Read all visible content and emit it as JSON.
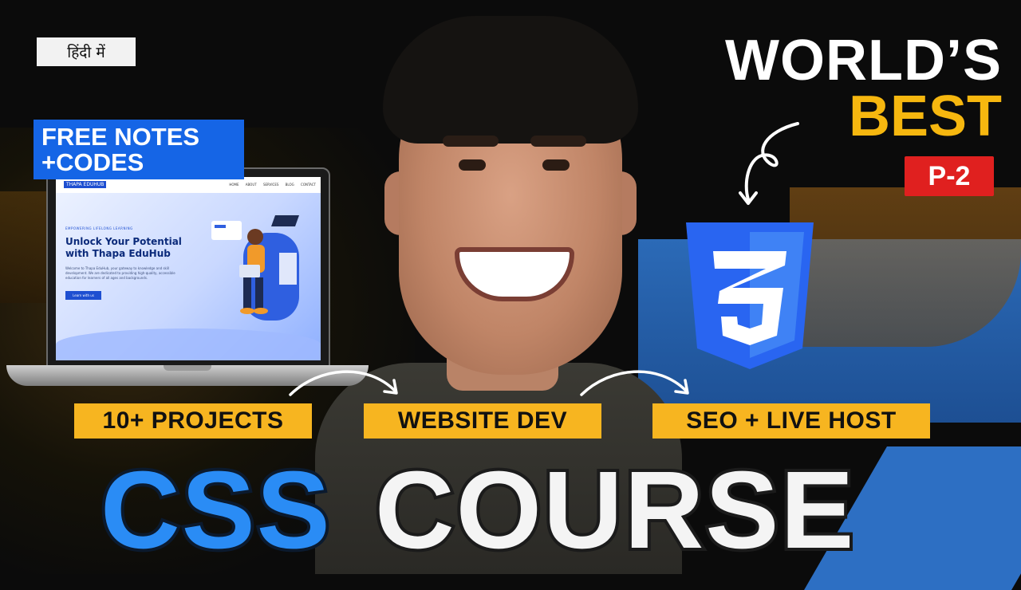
{
  "language_badge": "हिंदी में",
  "free_notes": {
    "line1": "FREE NOTES",
    "line2": "+CODES"
  },
  "headline": {
    "line1": "WORLD’S",
    "line2": "BEST"
  },
  "part_badge": "P-2",
  "tags": [
    "10+ PROJECTS",
    "WEBSITE DEV",
    "SEO + LIVE HOST"
  ],
  "title": {
    "css": "CSS",
    "course": "COURSE"
  },
  "laptop_site": {
    "logo": "THAPA EDUHUB",
    "nav": [
      "HOME",
      "ABOUT",
      "SERVICES",
      "BLOG",
      "CONTACT"
    ],
    "eyebrow": "EMPOWERING LIFELONG LEARNING",
    "heading": "Unlock Your Potential with Thapa EduHub",
    "body": "Welcome to Thapa EduHub, your gateway to knowledge and skill development. We are dedicated to providing high-quality, accessible education for learners of all ages and backgrounds.",
    "button": "Learn with us"
  },
  "colors": {
    "accent_yellow": "#f7b520",
    "accent_blue": "#2a8cf5",
    "badge_red": "#e0201f",
    "notes_blue": "#1565e6",
    "css3_blue": "#2965f1"
  },
  "icons": [
    "css3-logo-icon",
    "curved-arrow-icon"
  ]
}
